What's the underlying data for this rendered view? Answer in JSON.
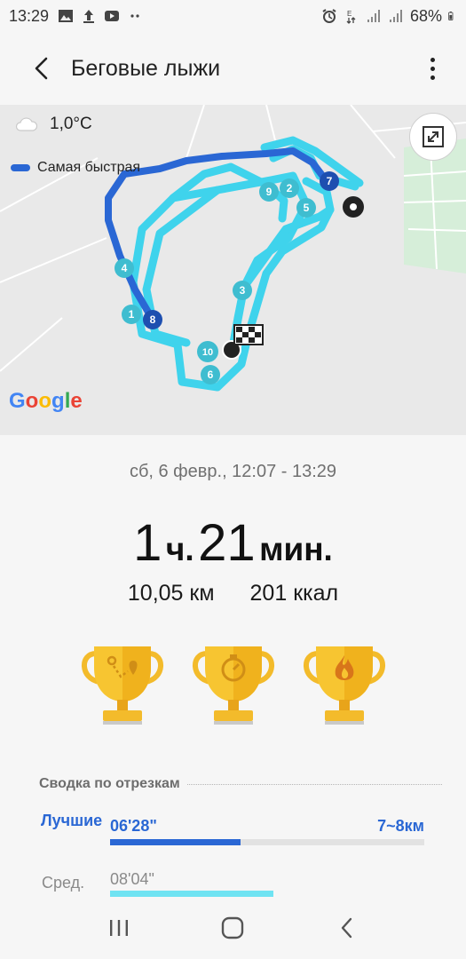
{
  "status_bar": {
    "time": "13:29",
    "battery": "68%",
    "icons_left": [
      "image-icon",
      "upload-icon",
      "youtube-icon",
      "more-notifications-icon"
    ],
    "icons_right": [
      "alarm-icon",
      "data-icon",
      "signal-icon",
      "signal-icon"
    ]
  },
  "app_bar": {
    "title": "Беговые лыжи"
  },
  "map": {
    "weather": "1,0°C",
    "legend_label": "Самая быстрая",
    "google": [
      "G",
      "o",
      "o",
      "g",
      "l",
      "e"
    ],
    "markers": [
      "1",
      "2",
      "3",
      "4",
      "5",
      "6",
      "7",
      "8",
      "9",
      "10"
    ],
    "colors": {
      "fastest": "#2a67d4",
      "route": "#3fd3ec"
    }
  },
  "workout": {
    "date_range": "сб, 6 февр., 12:07 - 13:29",
    "duration_h": "1",
    "duration_h_unit": "ч.",
    "duration_m": "21",
    "duration_m_unit": "мин.",
    "distance": "10,05 км",
    "calories": "201 ккал",
    "trophies": [
      "route-trophy-icon",
      "stopwatch-trophy-icon",
      "flame-trophy-icon"
    ]
  },
  "segments": {
    "header": "Сводка по отрезкам",
    "best_label": "Лучшие",
    "best_time": "06'28\"",
    "best_range": "7~8км",
    "best_fraction": 0.416,
    "avg_label": "Сред.",
    "avg_time": "08'04\"",
    "avg_fraction": 0.52
  }
}
